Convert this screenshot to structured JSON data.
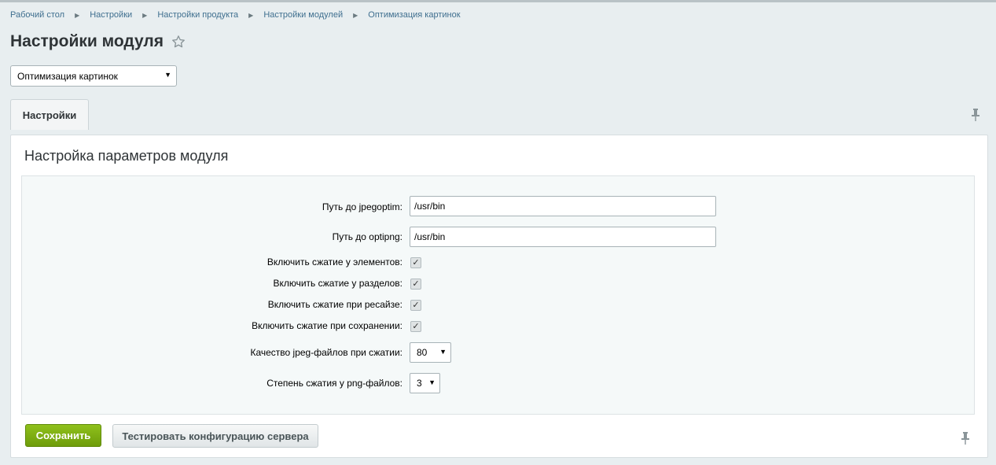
{
  "breadcrumb": [
    "Рабочий стол",
    "Настройки",
    "Настройки продукта",
    "Настройки модулей",
    "Оптимизация картинок"
  ],
  "page_title": "Настройки модуля",
  "module_select": {
    "value": "Оптимизация картинок"
  },
  "tabs": [
    {
      "label": "Настройки",
      "active": true
    }
  ],
  "panel": {
    "title": "Настройка параметров модуля",
    "fields": {
      "jpegoptim": {
        "label": "Путь до jpegoptim:",
        "value": "/usr/bin"
      },
      "optipng": {
        "label": "Путь до optipng:",
        "value": "/usr/bin"
      },
      "compress_elements": {
        "label": "Включить сжатие у элементов:",
        "checked": true
      },
      "compress_sections": {
        "label": "Включить сжатие у разделов:",
        "checked": true
      },
      "compress_resize": {
        "label": "Включить сжатие при ресайзе:",
        "checked": true
      },
      "compress_save": {
        "label": "Включить сжатие при сохранении:",
        "checked": true
      },
      "jpeg_quality": {
        "label": "Качество jpeg-файлов при сжатии:",
        "value": "80"
      },
      "png_level": {
        "label": "Степень сжатия у png-файлов:",
        "value": "3"
      }
    }
  },
  "buttons": {
    "save": "Сохранить",
    "test": "Тестировать конфигурацию сервера"
  },
  "icons": {
    "star": "star-icon",
    "pin": "pin-icon",
    "dropdown": "chevron-down-icon"
  },
  "colors": {
    "accent_green": "#7cb013",
    "link": "#3f6f8f",
    "background": "#e8eef0"
  }
}
